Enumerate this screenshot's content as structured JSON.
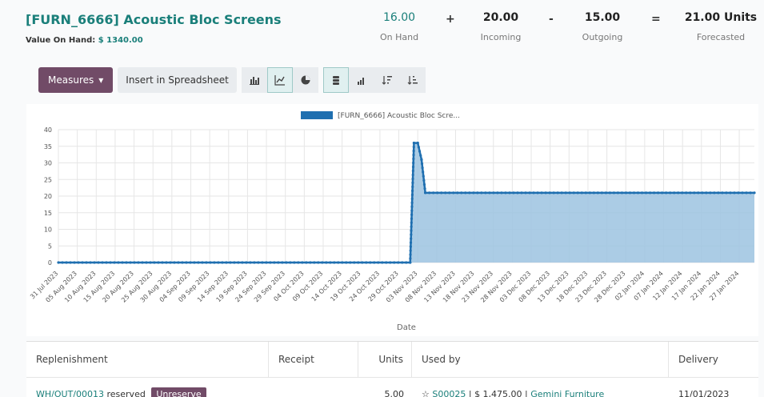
{
  "product": {
    "title": "[FURN_6666] Acoustic Bloc Screens",
    "value_label": "Value On Hand:",
    "value_amount": "$ 1340.00"
  },
  "stats": {
    "on_hand": {
      "value": "16.00",
      "label": "On Hand"
    },
    "incoming": {
      "value": "20.00",
      "label": "Incoming"
    },
    "outgoing": {
      "value": "15.00",
      "label": "Outgoing"
    },
    "forecasted": {
      "value": "21.00 Units",
      "label": "Forecasted"
    },
    "ops": {
      "plus": "+",
      "minus": "-",
      "equals": "="
    }
  },
  "toolbar": {
    "measures_label": "Measures",
    "spreadsheet_label": "Insert in Spreadsheet",
    "icons": [
      "bar-chart-icon",
      "line-chart-icon",
      "pie-chart-icon",
      "stacked-icon",
      "cumulative-icon",
      "sort-descending-icon",
      "sort-ascending-icon"
    ]
  },
  "chart_data": {
    "type": "area",
    "xlabel": "Date",
    "ylabel": "",
    "ylim": [
      0,
      40
    ],
    "yticks": [
      0,
      5,
      10,
      15,
      20,
      25,
      30,
      35,
      40
    ],
    "legend": "[FURN_6666] Acoustic Bloc Scre...",
    "legend_position": "top",
    "grid": true,
    "color": "#1f6fb0",
    "fill_color": "#9cc3e0",
    "x": [
      "31 Jul 2023",
      "05 Aug 2023",
      "10 Aug 2023",
      "15 Aug 2023",
      "20 Aug 2023",
      "25 Aug 2023",
      "30 Aug 2023",
      "04 Sep 2023",
      "09 Sep 2023",
      "14 Sep 2023",
      "19 Sep 2023",
      "24 Sep 2023",
      "29 Sep 2023",
      "04 Oct 2023",
      "09 Oct 2023",
      "14 Oct 2023",
      "19 Oct 2023",
      "24 Oct 2023",
      "29 Oct 2023",
      "03 Nov 2023",
      "08 Nov 2023",
      "13 Nov 2023",
      "18 Nov 2023",
      "23 Nov 2023",
      "28 Nov 2023",
      "03 Dec 2023",
      "08 Dec 2023",
      "13 Dec 2023",
      "18 Dec 2023",
      "23 Dec 2023",
      "28 Dec 2023",
      "02 Jan 2024",
      "07 Jan 2024",
      "12 Jan 2024",
      "17 Jan 2024",
      "22 Jan 2024",
      "27 Jan 2024"
    ],
    "series": [
      {
        "name": "[FURN_6666] Acoustic Bloc Scre...",
        "points": [
          {
            "x": "31 Jul 2023",
            "y": 0
          },
          {
            "x": "01 Nov 2023",
            "y": 0
          },
          {
            "x": "02 Nov 2023",
            "y": 36
          },
          {
            "x": "03 Nov 2023",
            "y": 36
          },
          {
            "x": "04 Nov 2023",
            "y": 31
          },
          {
            "x": "05 Nov 2023",
            "y": 21
          },
          {
            "x": "31 Jan 2024",
            "y": 21
          }
        ]
      }
    ]
  },
  "table": {
    "headers": [
      "Replenishment",
      "Receipt",
      "Units",
      "Used by",
      "Delivery"
    ],
    "rows": [
      {
        "replenishment": "WH/OUT/00013",
        "replenishment_status": "reserved",
        "badge": "Unreserve",
        "receipt": "",
        "units": "5.00",
        "used_by_ref": "S00025",
        "used_by_amount": "$ 1,475.00",
        "used_by_partner": "Gemini Furniture",
        "delivery": "11/01/2023"
      }
    ]
  }
}
